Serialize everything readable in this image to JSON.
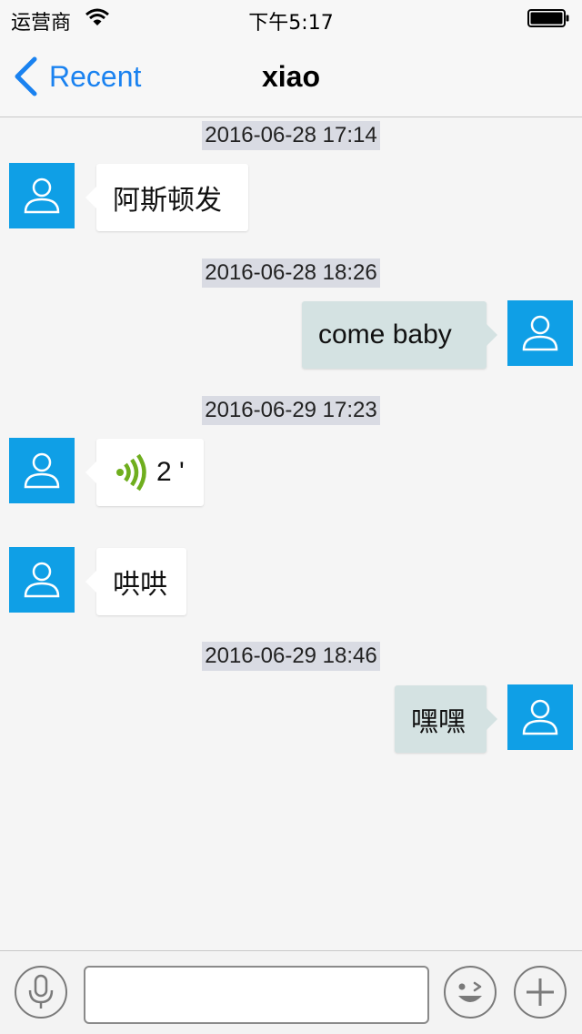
{
  "status_bar": {
    "carrier": "运营商",
    "time": "下午5:17"
  },
  "nav": {
    "back_label": "Recent",
    "title": "xiao"
  },
  "messages": [
    {
      "timestamp": "2016-06-28 17:14",
      "side": "left",
      "text": "阿斯顿发"
    },
    {
      "timestamp": "2016-06-28 18:26",
      "side": "right",
      "text": "come baby"
    },
    {
      "timestamp": "2016-06-29 17:23",
      "side": "left",
      "type": "voice",
      "text": "2 '"
    },
    {
      "side": "left",
      "text": "哄哄"
    },
    {
      "timestamp": "2016-06-29 18:46",
      "side": "right",
      "text": "嘿嘿"
    }
  ],
  "input": {
    "value": "",
    "placeholder": ""
  },
  "icons": {
    "back": "chevron-left-icon",
    "avatar": "user-icon",
    "voice": "voice-wave-icon",
    "mic": "microphone-icon",
    "emoji": "emoji-icon",
    "add": "plus-icon"
  },
  "colors": {
    "accent": "#1a82f0",
    "avatar": "#0f9fe6",
    "outgoing_bubble": "#d4e2e2",
    "timestamp_bg": "#d9dbe3"
  }
}
